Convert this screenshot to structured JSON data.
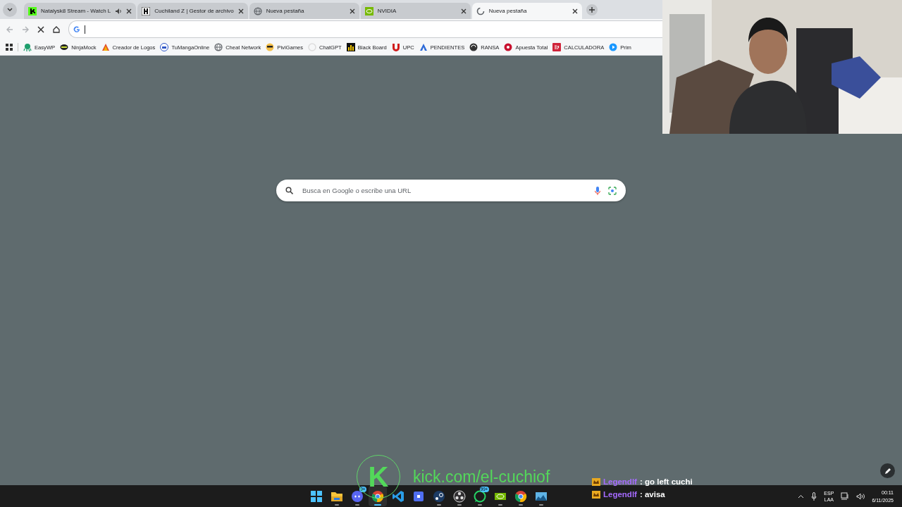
{
  "tabs": [
    {
      "title": "Natalysk8 Stream - Watch L",
      "audio": true,
      "selected": false
    },
    {
      "title": "Cuchiland Z | Gestor de archivo",
      "audio": false,
      "selected": false
    },
    {
      "title": "Nueva pestaña",
      "audio": false,
      "selected": false
    },
    {
      "title": "NVIDIA",
      "audio": false,
      "selected": false
    },
    {
      "title": "Nueva pestaña",
      "audio": false,
      "selected": true
    }
  ],
  "toolbar": {
    "loading": true
  },
  "bookmarks": [
    {
      "label": "EasyWP"
    },
    {
      "label": "NinjaMock"
    },
    {
      "label": "Creador de Logos"
    },
    {
      "label": "TuMangaOnline"
    },
    {
      "label": "Cheat Network"
    },
    {
      "label": "PiviGames"
    },
    {
      "label": "ChatGPT"
    },
    {
      "label": "Black Board"
    },
    {
      "label": "UPC"
    },
    {
      "label": "PENDIENTES"
    },
    {
      "label": "RANSA"
    },
    {
      "label": "Apuesta Total"
    },
    {
      "label": "CALCULADORA"
    },
    {
      "label": "Prim"
    }
  ],
  "search": {
    "placeholder": "Busca en Google o escribe una URL"
  },
  "overlay": {
    "logo": "K",
    "url": "kick.com/el-cuchiof"
  },
  "chat": [
    {
      "user": "Legendlf",
      "message": ": go left cuchi"
    },
    {
      "user": "Legendlf",
      "message": ": avisa"
    }
  ],
  "taskbar": {
    "apps": [
      {
        "kind": "start",
        "running": false,
        "active": false
      },
      {
        "kind": "folder",
        "running": true,
        "active": false
      },
      {
        "kind": "discord",
        "badge": "9+",
        "running": true,
        "active": false
      },
      {
        "kind": "chrome",
        "running": true,
        "active": true
      },
      {
        "kind": "vscode",
        "running": false,
        "active": false
      },
      {
        "kind": "roblox",
        "running": false,
        "active": false
      },
      {
        "kind": "steam",
        "running": true,
        "active": false
      },
      {
        "kind": "obs",
        "running": true,
        "active": false
      },
      {
        "kind": "whatsapp",
        "badge": "99+",
        "running": true,
        "active": false
      },
      {
        "kind": "nvidia",
        "running": true,
        "active": false
      },
      {
        "kind": "chrome",
        "running": true,
        "active": false
      },
      {
        "kind": "app",
        "running": true,
        "active": false
      }
    ],
    "lang": "ESP",
    "layout": "LAA",
    "time": "00:11",
    "date": "6/11/2025"
  }
}
